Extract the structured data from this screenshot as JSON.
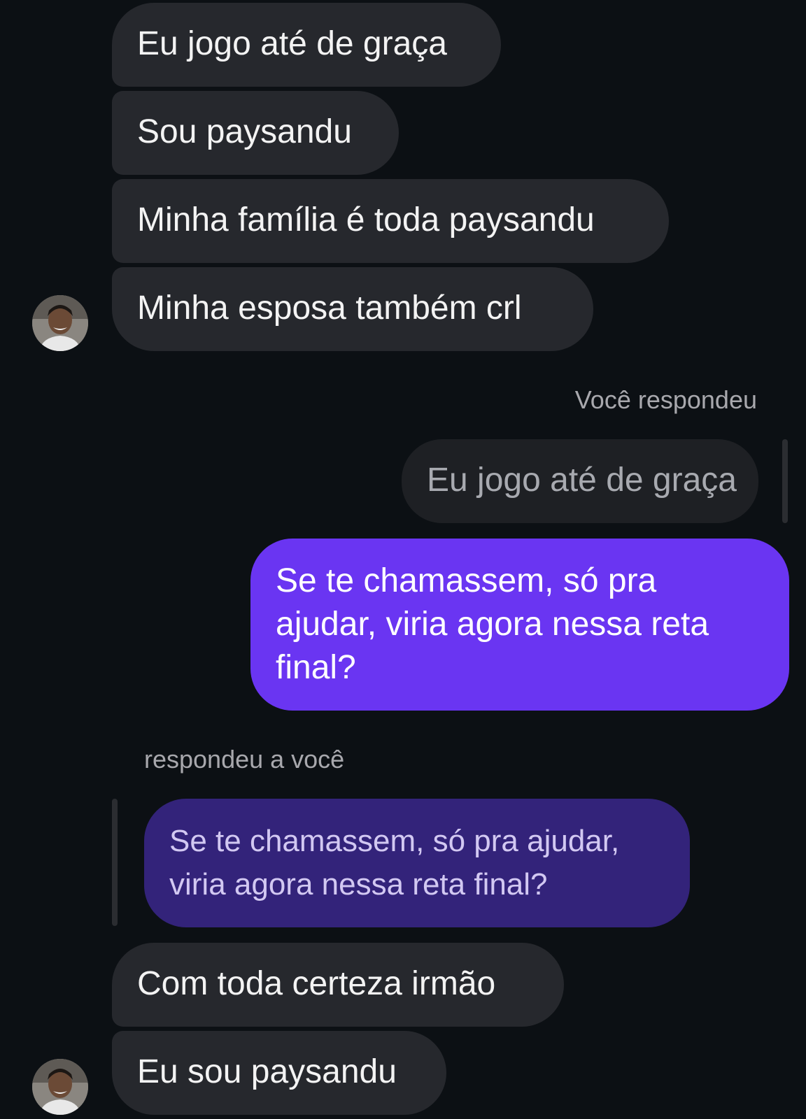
{
  "conversation": {
    "incoming_group_1": [
      "Eu jogo até de graça",
      "Sou paysandu",
      "Minha família é toda paysandu",
      "Minha esposa também crl"
    ],
    "you_replied_label": "Você respondeu",
    "quoted_original": "Eu jogo até de graça",
    "outgoing_message": "Se te chamassem, só pra ajudar, viria agora nessa reta final?",
    "replied_to_you_label": "respondeu a você",
    "quoted_outgoing": "Se te chamassem, só pra ajudar, viria agora nessa reta final?",
    "incoming_group_2": [
      "Com toda certeza irmão",
      "Eu sou paysandu"
    ]
  },
  "colors": {
    "background": "#0c1014",
    "incoming_bubble": "#26282d",
    "outgoing_bubble": "#6a35f2",
    "quoted_outgoing_bubble": "#33237a",
    "quoted_incoming_bubble": "#1e2024",
    "meta_text": "#a8a8ad"
  },
  "icons": {
    "avatar": "contact-avatar-photo"
  }
}
